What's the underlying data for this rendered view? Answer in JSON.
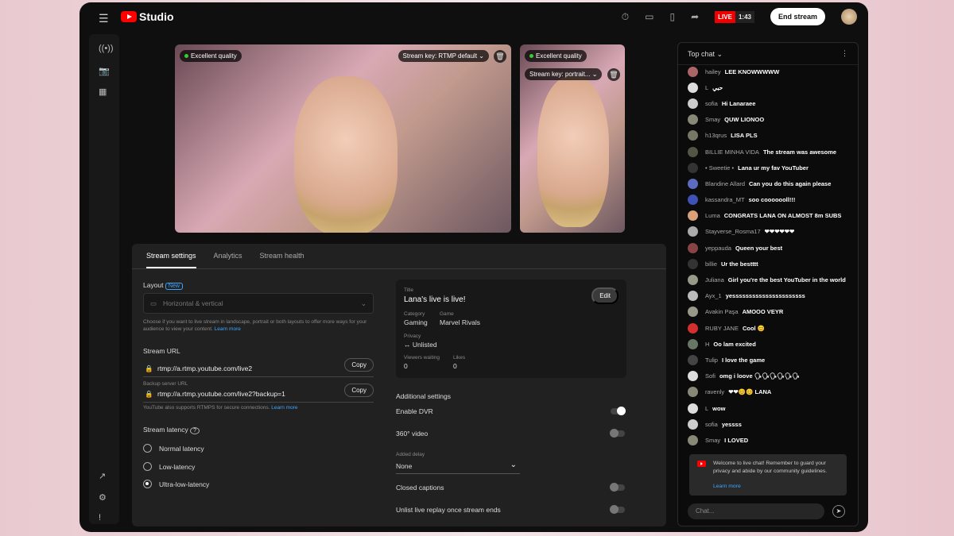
{
  "app": {
    "title": "Studio",
    "live_label": "LIVE",
    "live_time": "1:43",
    "end_stream": "End stream"
  },
  "previews": {
    "quality": "Excellent quality",
    "stream_key_main": "Stream key: RTMP default",
    "stream_key_vertical": "Stream key: portrait..."
  },
  "tabs": [
    "Stream settings",
    "Analytics",
    "Stream health"
  ],
  "layout": {
    "label": "Layout",
    "badge": "New",
    "value": "Horizontal & vertical",
    "help": "Choose if you want to live stream in landscape, portrait or both layouts to offer more ways for your audience to view your content.",
    "learn_more": "Learn more"
  },
  "stream_url": {
    "label": "Stream URL",
    "url": "rtmp://a.rtmp.youtube.com/live2",
    "backup_label": "Backup server URL",
    "backup_url": "rtmp://a.rtmp.youtube.com/live2?backup=1",
    "copy": "Copy",
    "note": "YouTube also supports RTMPS for secure connections.",
    "learn_more": "Learn more"
  },
  "latency": {
    "label": "Stream latency",
    "options": [
      "Normal latency",
      "Low-latency",
      "Ultra-low-latency"
    ],
    "selected": "Ultra-low-latency"
  },
  "details": {
    "title_label": "Title",
    "title": "Lana's live is live!",
    "edit": "Edit",
    "category_label": "Category",
    "category": "Gaming",
    "game_label": "Game",
    "game": "Marvel Rivals",
    "privacy_label": "Privacy",
    "privacy": "Unlisted",
    "viewers_label": "Viewers waiting",
    "viewers": "0",
    "likes_label": "Likes",
    "likes": "0"
  },
  "additional": {
    "label": "Additional settings",
    "dvr": "Enable DVR",
    "dvr_on": true,
    "video360": "360° video",
    "video360_on": false,
    "delay_label": "Added delay",
    "delay": "None",
    "captions": "Closed captions",
    "captions_on": false,
    "unlist": "Unlist live replay once stream ends",
    "unlist_on": false
  },
  "chat": {
    "mode": "Top chat",
    "messages": [
      {
        "author": "hailey",
        "text": "LEE KNOWWWWW",
        "color": "#a66"
      },
      {
        "author": "L",
        "text": "حبي",
        "color": "#ddd"
      },
      {
        "author": "sofia",
        "text": "Hi Lanaraee",
        "color": "#ccc"
      },
      {
        "author": "Smay",
        "text": "QUW LIONOO",
        "color": "#887"
      },
      {
        "author": "h13qrus",
        "text": "LISA PLS",
        "color": "#776"
      },
      {
        "author": "BILLIE MINHA VIDA",
        "text": "The stream was awesome",
        "color": "#554"
      },
      {
        "author": "• Sweetie •",
        "text": "Lana ur my fav YouTuber",
        "color": "#333"
      },
      {
        "author": "Blandine Allard",
        "text": "Can you do this again please",
        "color": "#5c6bc0"
      },
      {
        "author": "kassandra_MT",
        "text": "soo cooooooll!!!",
        "color": "#3f51b5"
      },
      {
        "author": "Luma",
        "text": "CONGRATS LANA ON ALMOST 8m SUBS",
        "color": "#d9a07a"
      },
      {
        "author": "Stayverse_Rosma17",
        "text": "❤❤❤❤❤❤",
        "color": "#aaa"
      },
      {
        "author": "yeppauda",
        "text": "Queen your best",
        "color": "#844"
      },
      {
        "author": "billie",
        "text": "Ur the bestttt",
        "color": "#333"
      },
      {
        "author": "Juliana",
        "text": "Girl you're the best YouTuber in the world",
        "color": "#998"
      },
      {
        "author": "Ayx_1",
        "text": "yessssssssssssssssssssss",
        "color": "#bbb"
      },
      {
        "author": "Avakin Paşa",
        "text": "AMOOO VEYR",
        "color": "#998"
      },
      {
        "author": "RUBY JANE",
        "text": "Cool 😊",
        "color": "#d32f2f"
      },
      {
        "author": "H",
        "text": "Oo lam excited",
        "color": "#676"
      },
      {
        "author": "Tulip",
        "text": "I love the game",
        "color": "#444"
      },
      {
        "author": "Sofi",
        "text": "omg i loove 🗣🗣🗣🗣🗣🗣",
        "color": "#ddd"
      },
      {
        "author": "ravenly",
        "text": "❤❤😊😊 LANA",
        "color": "#887"
      },
      {
        "author": "L",
        "text": "wow",
        "color": "#ddd"
      },
      {
        "author": "sofia",
        "text": "yessss",
        "color": "#ccc"
      },
      {
        "author": "Smay",
        "text": "I LOVED",
        "color": "#887"
      }
    ],
    "welcome": "Welcome to live chat! Remember to guard your privacy and abide by our community guidelines.",
    "learn_more": "Learn more",
    "placeholder": "Chat..."
  }
}
